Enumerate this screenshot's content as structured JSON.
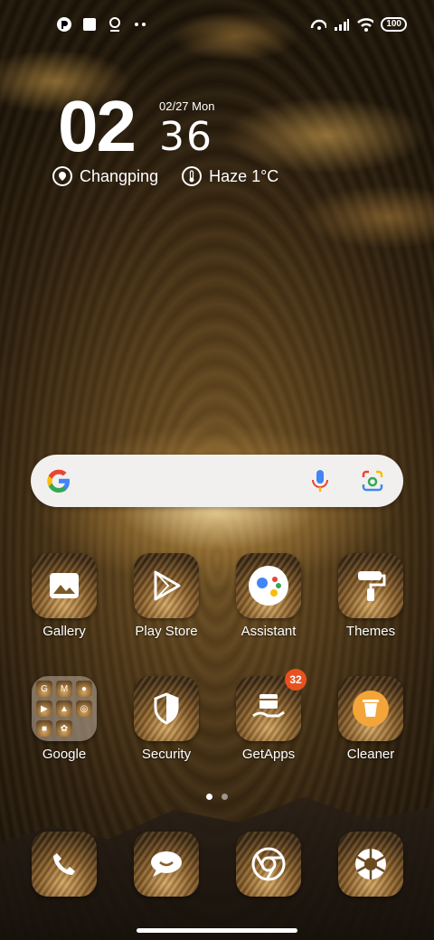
{
  "status_bar": {
    "battery": "100",
    "left_icons": [
      "notification-app-icon",
      "square-icon",
      "location-pin-icon",
      "more-dots-icon"
    ],
    "right_icons": [
      "hotspot-icon",
      "signal-icon",
      "wifi-icon",
      "battery-icon"
    ]
  },
  "clock": {
    "hour": "02",
    "minute": "36",
    "date": "02/27 Mon",
    "location": "Changping",
    "weather": "Haze 1°C"
  },
  "search": {
    "icons": [
      "google-icon",
      "microphone-icon",
      "lens-icon"
    ]
  },
  "apps_row1": [
    {
      "label": "Gallery",
      "icon": "gallery-icon"
    },
    {
      "label": "Play Store",
      "icon": "play-store-icon"
    },
    {
      "label": "Assistant",
      "icon": "assistant-icon"
    },
    {
      "label": "Themes",
      "icon": "paint-roller-icon"
    }
  ],
  "apps_row2": [
    {
      "label": "Google",
      "icon": "folder-icon"
    },
    {
      "label": "Security",
      "icon": "shield-icon"
    },
    {
      "label": "GetApps",
      "icon": "getapps-icon",
      "badge": "32"
    },
    {
      "label": "Cleaner",
      "icon": "trash-icon"
    }
  ],
  "dock": [
    {
      "icon": "phone-icon"
    },
    {
      "icon": "messaging-icon"
    },
    {
      "icon": "chrome-icon"
    },
    {
      "icon": "camera-icon"
    }
  ],
  "page_indicator": {
    "pages": 2,
    "current": 1
  },
  "colors": {
    "badge": "#e8521f",
    "search_bg": "#f1f0ee"
  }
}
